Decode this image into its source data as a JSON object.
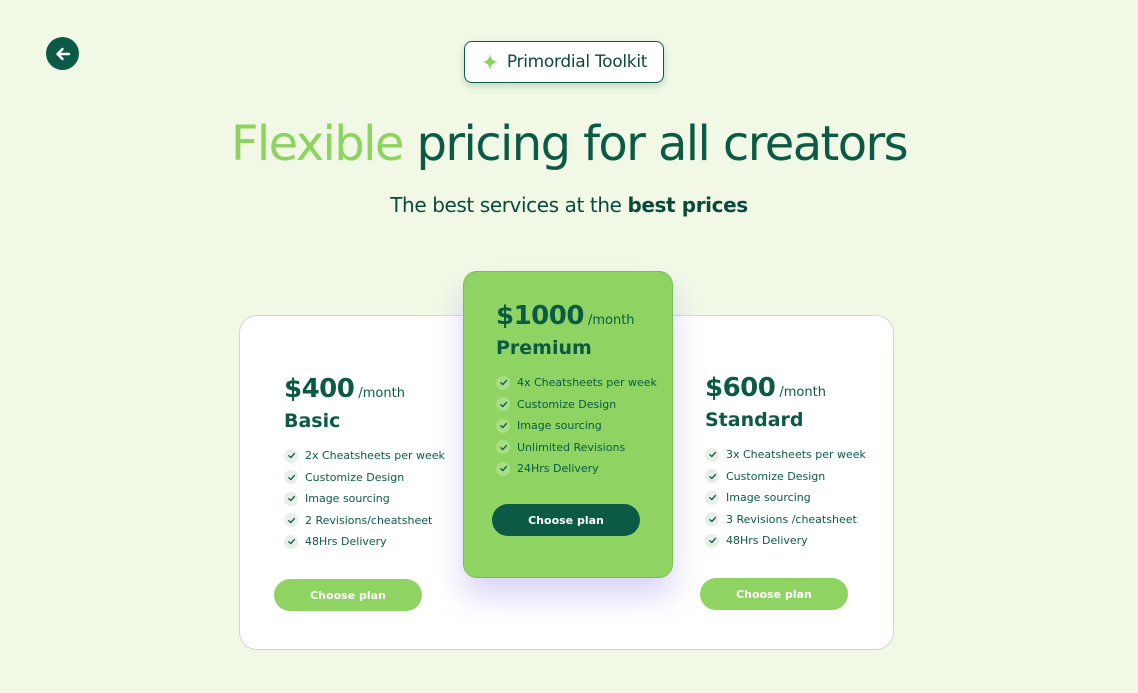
{
  "nav": {
    "back_icon": "arrow-left-icon"
  },
  "badge": {
    "icon": "sparkle-icon",
    "label": "Primordial Toolkit"
  },
  "hero": {
    "title_accent": "Flexible",
    "title_rest": " pricing for all creators",
    "subtitle_pre": "The best services at the ",
    "subtitle_bold": "best prices"
  },
  "plans": {
    "basic": {
      "price": "$400",
      "period": "/month",
      "name": "Basic",
      "features": [
        "2x Cheatsheets per week",
        "Customize Design",
        "Image sourcing",
        "2 Revisions/cheatsheet",
        "48Hrs Delivery"
      ],
      "cta": "Choose plan"
    },
    "premium": {
      "price": "$1000",
      "period": "/month",
      "name": "Premium",
      "features": [
        "4x Cheatsheets per week",
        "Customize Design",
        "Image sourcing",
        "Unlimited Revisions",
        "24Hrs Delivery"
      ],
      "cta": "Choose plan"
    },
    "standard": {
      "price": "$600",
      "period": "/month",
      "name": "Standard",
      "features": [
        "3x Cheatsheets per week",
        "Customize Design",
        "Image sourcing",
        "3 Revisions /cheatsheet",
        "48Hrs Delivery"
      ],
      "cta": "Choose plan"
    }
  },
  "colors": {
    "background": "#f1f9e6",
    "primary_dark": "#0b5a45",
    "accent_green": "#8fd463",
    "card": "#ffffff"
  }
}
